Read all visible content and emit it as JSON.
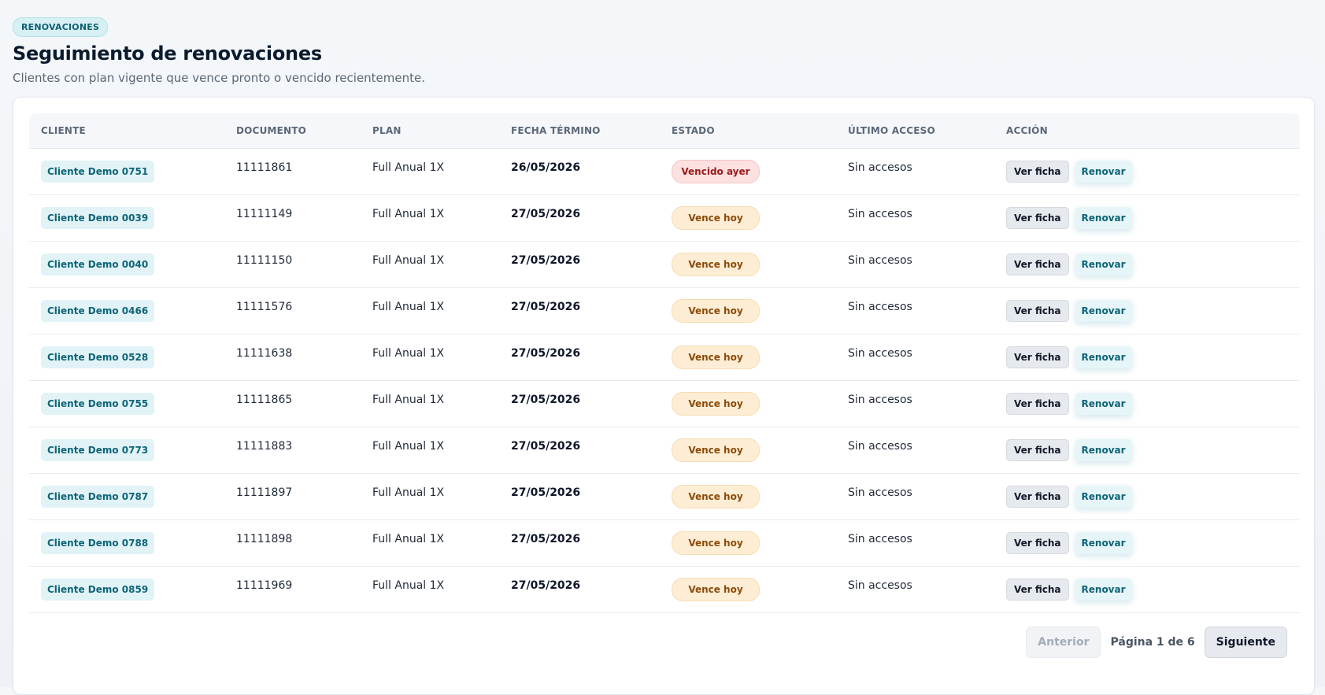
{
  "header": {
    "eyebrow": "RENOVACIONES",
    "title": "Seguimiento de renovaciones",
    "subtitle": "Clientes con plan vigente que vence pronto o vencido recientemente."
  },
  "table": {
    "columns": [
      "CLIENTE",
      "DOCUMENTO",
      "PLAN",
      "FECHA TÉRMINO",
      "ESTADO",
      "ÚLTIMO ACCESO",
      "ACCIÓN"
    ],
    "rows": [
      {
        "client": "Cliente Demo 0751",
        "document": "11111861",
        "plan": "Full Anual 1X",
        "end_date": "26/05/2026",
        "status": "Vencido ayer",
        "last_access": "Sin accesos"
      },
      {
        "client": "Cliente Demo 0039",
        "document": "11111149",
        "plan": "Full Anual 1X",
        "end_date": "27/05/2026",
        "status": "Vence hoy",
        "last_access": "Sin accesos"
      },
      {
        "client": "Cliente Demo 0040",
        "document": "11111150",
        "plan": "Full Anual 1X",
        "end_date": "27/05/2026",
        "status": "Vence hoy",
        "last_access": "Sin accesos"
      },
      {
        "client": "Cliente Demo 0466",
        "document": "11111576",
        "plan": "Full Anual 1X",
        "end_date": "27/05/2026",
        "status": "Vence hoy",
        "last_access": "Sin accesos"
      },
      {
        "client": "Cliente Demo 0528",
        "document": "11111638",
        "plan": "Full Anual 1X",
        "end_date": "27/05/2026",
        "status": "Vence hoy",
        "last_access": "Sin accesos"
      },
      {
        "client": "Cliente Demo 0755",
        "document": "11111865",
        "plan": "Full Anual 1X",
        "end_date": "27/05/2026",
        "status": "Vence hoy",
        "last_access": "Sin accesos"
      },
      {
        "client": "Cliente Demo 0773",
        "document": "11111883",
        "plan": "Full Anual 1X",
        "end_date": "27/05/2026",
        "status": "Vence hoy",
        "last_access": "Sin accesos"
      },
      {
        "client": "Cliente Demo 0787",
        "document": "11111897",
        "plan": "Full Anual 1X",
        "end_date": "27/05/2026",
        "status": "Vence hoy",
        "last_access": "Sin accesos"
      },
      {
        "client": "Cliente Demo 0788",
        "document": "11111898",
        "plan": "Full Anual 1X",
        "end_date": "27/05/2026",
        "status": "Vence hoy",
        "last_access": "Sin accesos"
      },
      {
        "client": "Cliente Demo 0859",
        "document": "11111969",
        "plan": "Full Anual 1X",
        "end_date": "27/05/2026",
        "status": "Vence hoy",
        "last_access": "Sin accesos"
      }
    ],
    "actions": {
      "view_label": "Ver ficha",
      "renew_label": "Renovar"
    }
  },
  "pagination": {
    "prev_label": "Anterior",
    "page_label": "Página 1 de 6",
    "next_label": "Siguiente"
  },
  "colors": {
    "accent": "#0e6478",
    "expired_text": "#991b1b",
    "expired_bg": "#fde1e1",
    "today_text": "#8a4b0a",
    "today_bg": "#fdedd5"
  }
}
